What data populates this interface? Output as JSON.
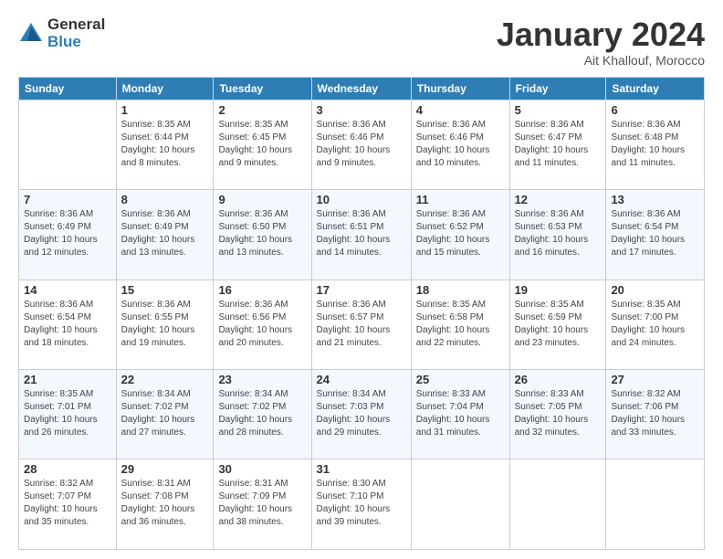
{
  "logo": {
    "general": "General",
    "blue": "Blue"
  },
  "title": "January 2024",
  "location": "Ait Khallouf, Morocco",
  "days_header": [
    "Sunday",
    "Monday",
    "Tuesday",
    "Wednesday",
    "Thursday",
    "Friday",
    "Saturday"
  ],
  "weeks": [
    [
      {
        "day": "",
        "info": ""
      },
      {
        "day": "1",
        "info": "Sunrise: 8:35 AM\nSunset: 6:44 PM\nDaylight: 10 hours\nand 8 minutes."
      },
      {
        "day": "2",
        "info": "Sunrise: 8:35 AM\nSunset: 6:45 PM\nDaylight: 10 hours\nand 9 minutes."
      },
      {
        "day": "3",
        "info": "Sunrise: 8:36 AM\nSunset: 6:46 PM\nDaylight: 10 hours\nand 9 minutes."
      },
      {
        "day": "4",
        "info": "Sunrise: 8:36 AM\nSunset: 6:46 PM\nDaylight: 10 hours\nand 10 minutes."
      },
      {
        "day": "5",
        "info": "Sunrise: 8:36 AM\nSunset: 6:47 PM\nDaylight: 10 hours\nand 11 minutes."
      },
      {
        "day": "6",
        "info": "Sunrise: 8:36 AM\nSunset: 6:48 PM\nDaylight: 10 hours\nand 11 minutes."
      }
    ],
    [
      {
        "day": "7",
        "info": "Sunrise: 8:36 AM\nSunset: 6:49 PM\nDaylight: 10 hours\nand 12 minutes."
      },
      {
        "day": "8",
        "info": "Sunrise: 8:36 AM\nSunset: 6:49 PM\nDaylight: 10 hours\nand 13 minutes."
      },
      {
        "day": "9",
        "info": "Sunrise: 8:36 AM\nSunset: 6:50 PM\nDaylight: 10 hours\nand 13 minutes."
      },
      {
        "day": "10",
        "info": "Sunrise: 8:36 AM\nSunset: 6:51 PM\nDaylight: 10 hours\nand 14 minutes."
      },
      {
        "day": "11",
        "info": "Sunrise: 8:36 AM\nSunset: 6:52 PM\nDaylight: 10 hours\nand 15 minutes."
      },
      {
        "day": "12",
        "info": "Sunrise: 8:36 AM\nSunset: 6:53 PM\nDaylight: 10 hours\nand 16 minutes."
      },
      {
        "day": "13",
        "info": "Sunrise: 8:36 AM\nSunset: 6:54 PM\nDaylight: 10 hours\nand 17 minutes."
      }
    ],
    [
      {
        "day": "14",
        "info": "Sunrise: 8:36 AM\nSunset: 6:54 PM\nDaylight: 10 hours\nand 18 minutes."
      },
      {
        "day": "15",
        "info": "Sunrise: 8:36 AM\nSunset: 6:55 PM\nDaylight: 10 hours\nand 19 minutes."
      },
      {
        "day": "16",
        "info": "Sunrise: 8:36 AM\nSunset: 6:56 PM\nDaylight: 10 hours\nand 20 minutes."
      },
      {
        "day": "17",
        "info": "Sunrise: 8:36 AM\nSunset: 6:57 PM\nDaylight: 10 hours\nand 21 minutes."
      },
      {
        "day": "18",
        "info": "Sunrise: 8:35 AM\nSunset: 6:58 PM\nDaylight: 10 hours\nand 22 minutes."
      },
      {
        "day": "19",
        "info": "Sunrise: 8:35 AM\nSunset: 6:59 PM\nDaylight: 10 hours\nand 23 minutes."
      },
      {
        "day": "20",
        "info": "Sunrise: 8:35 AM\nSunset: 7:00 PM\nDaylight: 10 hours\nand 24 minutes."
      }
    ],
    [
      {
        "day": "21",
        "info": "Sunrise: 8:35 AM\nSunset: 7:01 PM\nDaylight: 10 hours\nand 26 minutes."
      },
      {
        "day": "22",
        "info": "Sunrise: 8:34 AM\nSunset: 7:02 PM\nDaylight: 10 hours\nand 27 minutes."
      },
      {
        "day": "23",
        "info": "Sunrise: 8:34 AM\nSunset: 7:02 PM\nDaylight: 10 hours\nand 28 minutes."
      },
      {
        "day": "24",
        "info": "Sunrise: 8:34 AM\nSunset: 7:03 PM\nDaylight: 10 hours\nand 29 minutes."
      },
      {
        "day": "25",
        "info": "Sunrise: 8:33 AM\nSunset: 7:04 PM\nDaylight: 10 hours\nand 31 minutes."
      },
      {
        "day": "26",
        "info": "Sunrise: 8:33 AM\nSunset: 7:05 PM\nDaylight: 10 hours\nand 32 minutes."
      },
      {
        "day": "27",
        "info": "Sunrise: 8:32 AM\nSunset: 7:06 PM\nDaylight: 10 hours\nand 33 minutes."
      }
    ],
    [
      {
        "day": "28",
        "info": "Sunrise: 8:32 AM\nSunset: 7:07 PM\nDaylight: 10 hours\nand 35 minutes."
      },
      {
        "day": "29",
        "info": "Sunrise: 8:31 AM\nSunset: 7:08 PM\nDaylight: 10 hours\nand 36 minutes."
      },
      {
        "day": "30",
        "info": "Sunrise: 8:31 AM\nSunset: 7:09 PM\nDaylight: 10 hours\nand 38 minutes."
      },
      {
        "day": "31",
        "info": "Sunrise: 8:30 AM\nSunset: 7:10 PM\nDaylight: 10 hours\nand 39 minutes."
      },
      {
        "day": "",
        "info": ""
      },
      {
        "day": "",
        "info": ""
      },
      {
        "day": "",
        "info": ""
      }
    ]
  ]
}
